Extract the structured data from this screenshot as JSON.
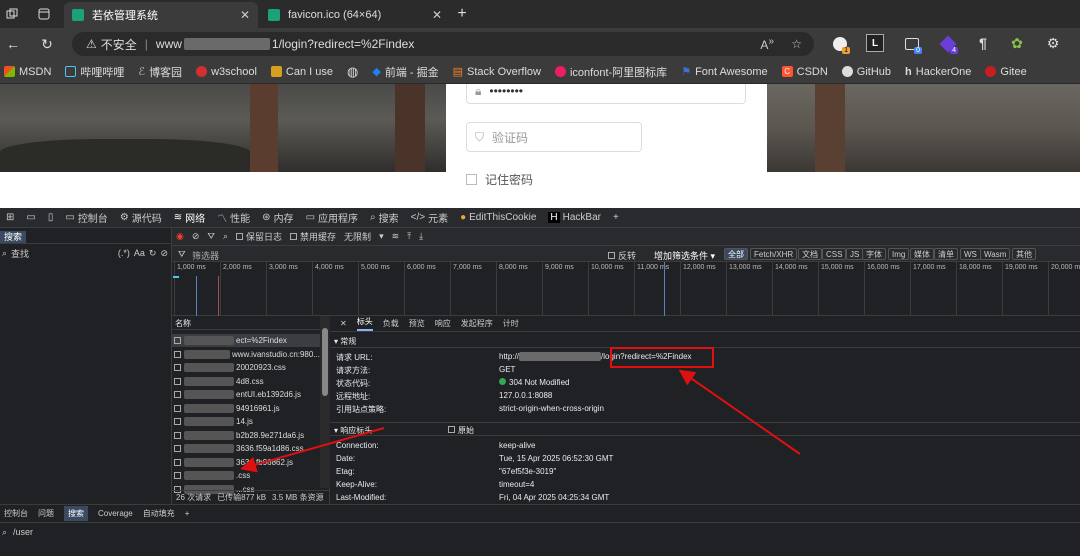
{
  "tabs": [
    {
      "title": "若依管理系统",
      "active": true
    },
    {
      "title": "favicon.ico (64×64)",
      "active": false
    }
  ],
  "address": {
    "security": "不安全",
    "url_prefix": "www",
    "url_suffix": "1/login?redirect=%2Findex"
  },
  "extension_badges": [
    "1",
    "0",
    "4"
  ],
  "bookmarks": [
    {
      "label": "MSDN",
      "color": "#e8eaed"
    },
    {
      "label": "哔哩哔哩",
      "color": "#4fc3f7"
    },
    {
      "label": "博客园",
      "color": "#888"
    },
    {
      "label": "w3school",
      "color": "#d32f2f"
    },
    {
      "label": "Can I use",
      "color": "#d5a020"
    },
    {
      "label": "",
      "color": "#bbb"
    },
    {
      "label": "前端 - 掘金",
      "color": "#1e80ff"
    },
    {
      "label": "Stack Overflow",
      "color": "#f48024"
    },
    {
      "label": "iconfont-阿里图标库",
      "color": "#e91e63"
    },
    {
      "label": "Font Awesome",
      "color": "#3f6fd8"
    },
    {
      "label": "CSDN",
      "color": "#fc5531"
    },
    {
      "label": "GitHub",
      "color": "#ddd"
    },
    {
      "label": "HackerOne",
      "color": "#ddd"
    },
    {
      "label": "Gitee",
      "color": "#c71d23"
    }
  ],
  "login": {
    "password_mask": "••••••••",
    "captcha_placeholder": "验证码",
    "remember": "记住密码"
  },
  "devtools": {
    "tabs": [
      "控制台",
      "源代码",
      "网络",
      "性能",
      "内存",
      "应用程序",
      "搜索",
      "元素",
      "EditThisCookie",
      "HackBar"
    ],
    "left": {
      "search_tab": "搜索",
      "find_label": "查找",
      "regex": "(.*)",
      "case": "Aa"
    },
    "net_toolbar": [
      "保留日志",
      "禁用缓存",
      "无限制"
    ],
    "filter_placeholder": "筛选器",
    "invert": "反转",
    "more_filters": "增加筛选条件",
    "type_filters": [
      "全部",
      "Fetch/XHR",
      "文档",
      "CSS",
      "JS",
      "字体",
      "Img",
      "媒体",
      "清单",
      "WS",
      "Wasm",
      "其他"
    ],
    "timeline_ticks": [
      "1,000 ms",
      "2,000 ms",
      "3,000 ms",
      "4,000 ms",
      "5,000 ms",
      "6,000 ms",
      "7,000 ms",
      "8,000 ms",
      "9,000 ms",
      "10,000 ms",
      "11,000 ms",
      "12,000 ms",
      "13,000 ms",
      "14,000 ms",
      "15,000 ms",
      "16,000 ms",
      "17,000 ms",
      "18,000 ms",
      "19,000 ms",
      "20,000 ms"
    ],
    "name_header": "名称",
    "requests": [
      "ect=%2Findex",
      "www.ivanstudio.cn:980...",
      "20020923.css",
      "4d8.css",
      "entUI.eb1392d6.js",
      "94916961.js",
      "14.js",
      "b2b28.9e271da6.js",
      "3636.f59a1d86.css",
      "3636.fb96862.js",
      ".css",
      "...css"
    ],
    "summary": [
      "26 次请求",
      "已传输877 kB",
      "3.5 MB 条资源"
    ],
    "detail_tabs": [
      "标头",
      "负载",
      "预览",
      "响应",
      "发起程序",
      "计时"
    ],
    "general_title": "常规",
    "general": [
      {
        "k": "请求 URL:",
        "v": "/login?redirect=%2Findex",
        "prefix": "http://"
      },
      {
        "k": "请求方法:",
        "v": "GET"
      },
      {
        "k": "状态代码:",
        "v": "304 Not Modified"
      },
      {
        "k": "远程地址:",
        "v": "127.0.0.1:8088"
      },
      {
        "k": "引用站点策略:",
        "v": "strict-origin-when-cross-origin"
      }
    ],
    "resp_title": "响应标头",
    "raw_label": "原始",
    "resp": [
      {
        "k": "Connection:",
        "v": "keep-alive"
      },
      {
        "k": "Date:",
        "v": "Tue, 15 Apr 2025 06:52:30 GMT"
      },
      {
        "k": "Etag:",
        "v": "\"67ef5f3e-3019\""
      },
      {
        "k": "Keep-Alive:",
        "v": "timeout=4"
      },
      {
        "k": "Last-Modified:",
        "v": "Fri, 04 Apr 2025 04:25:34 GMT"
      }
    ],
    "drawer_tabs": [
      "控制台",
      "问题",
      "搜索",
      "Coverage",
      "自动填充"
    ],
    "drawer_search": "/user"
  }
}
